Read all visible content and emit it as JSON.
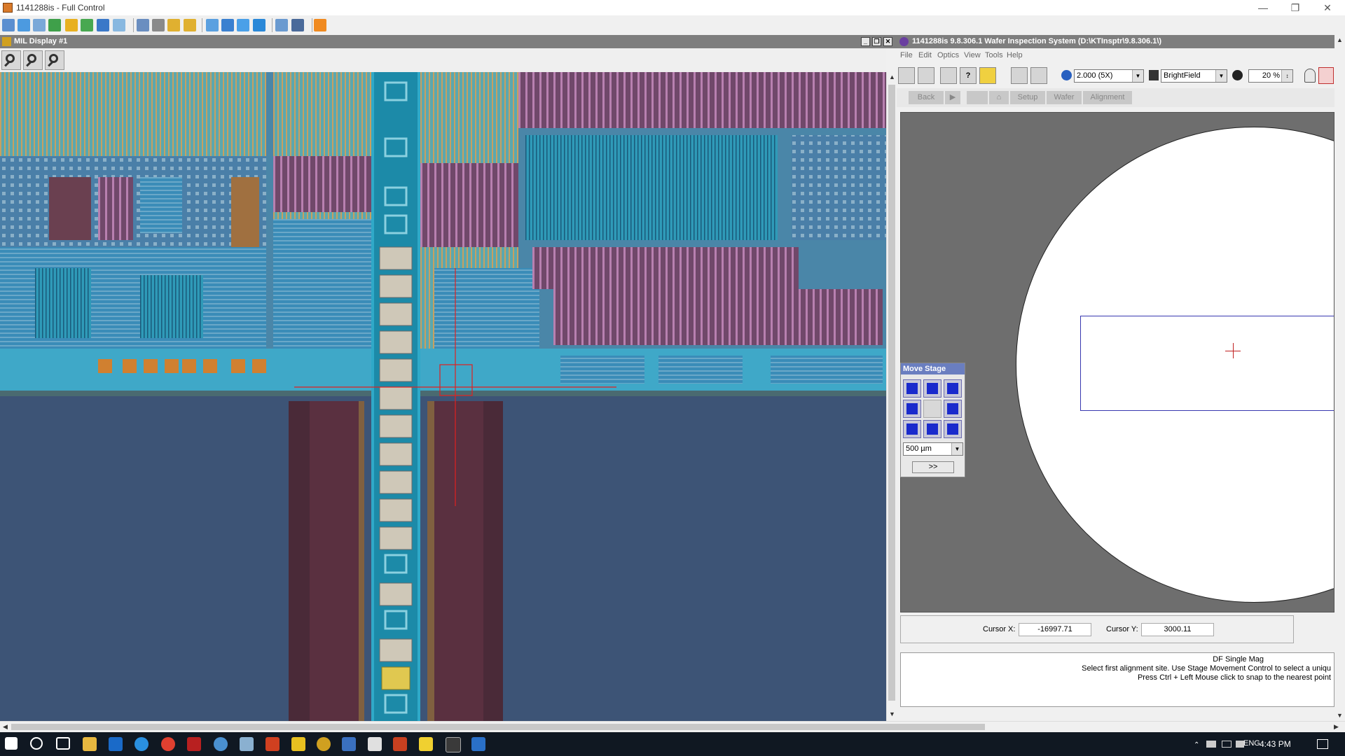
{
  "window": {
    "title": "1141288is - Full Control"
  },
  "mil_display": {
    "title": "MIL Display #1"
  },
  "wafer_app": {
    "title": "1141288is  9.8.306.1  Wafer Inspection System (D:\\KTInsptr\\9.8.306.1\\)",
    "menu": [
      "File",
      "Edit",
      "Optics",
      "View",
      "Tools",
      "Help"
    ],
    "magnification": "2.000 (5X)",
    "illumination": "BrightField",
    "light_level": "20 %",
    "nav": {
      "back": "Back",
      "setup": "Setup",
      "wafer": "Wafer",
      "alignment": "Alignment"
    }
  },
  "move_stage": {
    "title": "Move Stage",
    "step": "500 µm",
    "expand": ">>"
  },
  "cursor": {
    "x_label": "Cursor X:",
    "x_value": "-16997.71",
    "y_label": "Cursor Y:",
    "y_value": "3000.11"
  },
  "status": {
    "line1": "DF Single Mag",
    "line2": "Select first alignment site. Use Stage Movement Control to select a uniqu",
    "line3": "Press Ctrl + Left Mouse click to snap to the nearest point"
  },
  "taskbar": {
    "lang": "ENG",
    "time": "4:43 PM"
  },
  "colors": {
    "chip_bg": "#3d5476",
    "street": "#5a3040",
    "pad_column": "#2fa9c8",
    "crosshair": "#e02020",
    "title_gray": "#7e7e7e"
  }
}
